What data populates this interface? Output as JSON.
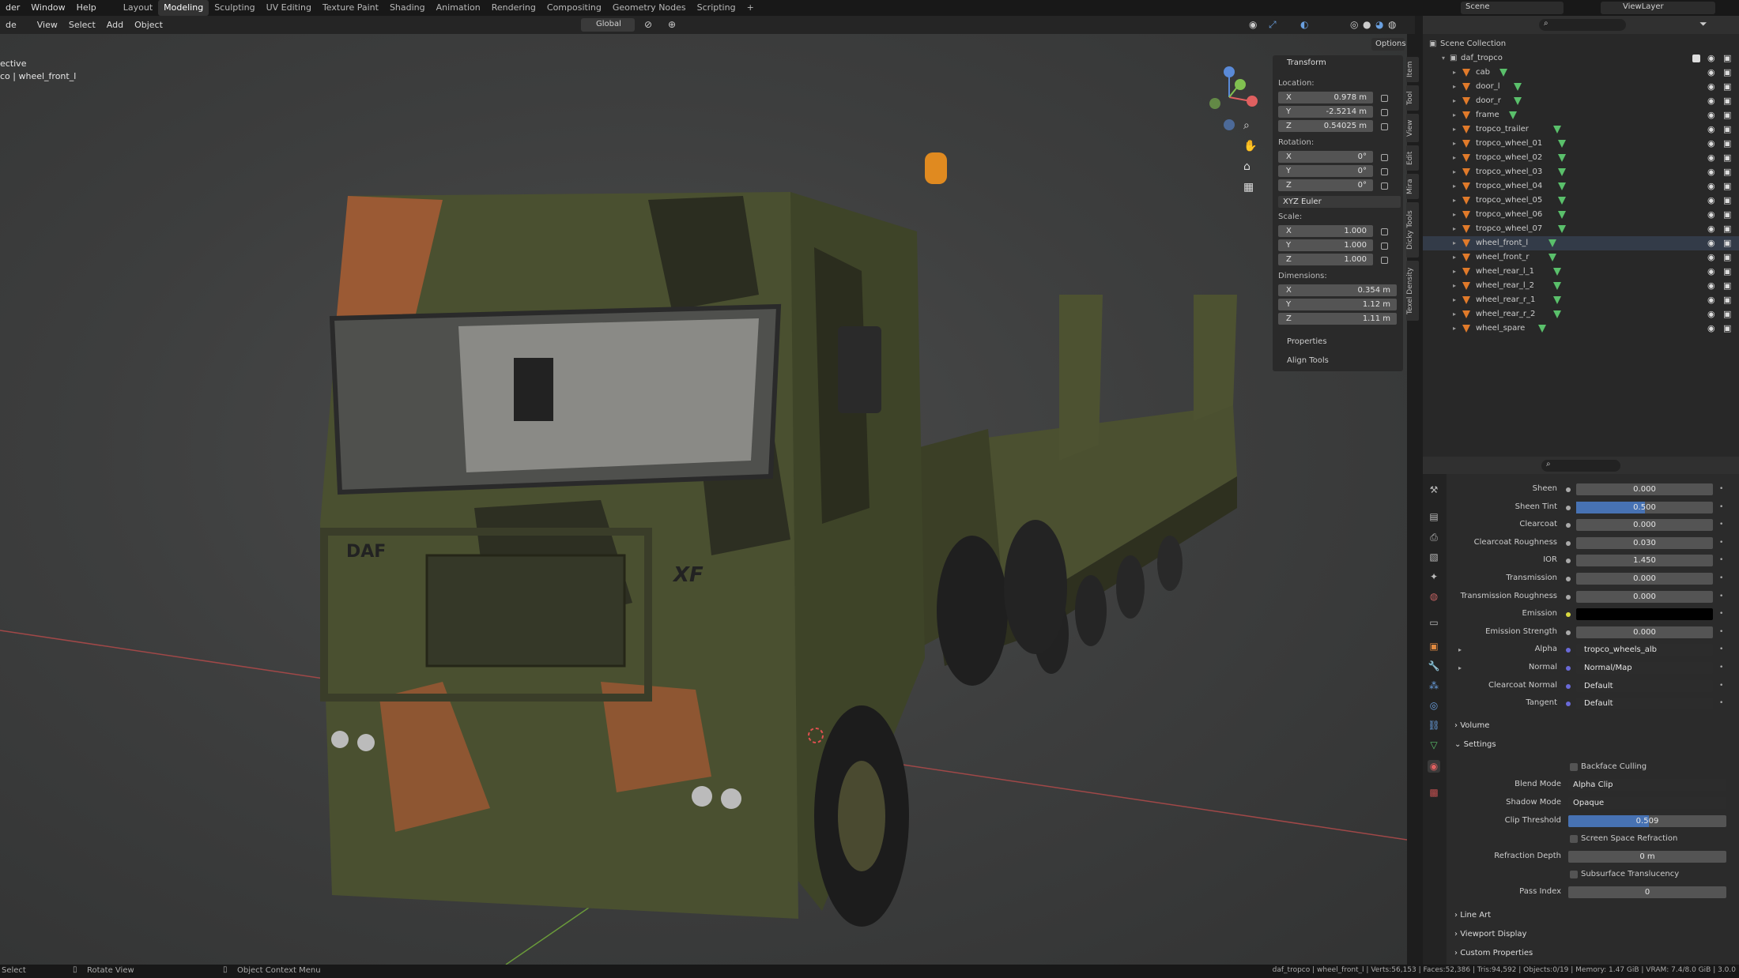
{
  "topbar": {
    "menus": [
      "der",
      "Window",
      "Help"
    ],
    "workspaces": [
      "Layout",
      "Modeling",
      "Sculpting",
      "UV Editing",
      "Texture Paint",
      "Shading",
      "Animation",
      "Rendering",
      "Compositing",
      "Geometry Nodes",
      "Scripting",
      "+"
    ],
    "active_workspace": "Modeling",
    "scene": "Scene",
    "view_layer": "ViewLayer"
  },
  "viewport_header": {
    "mode": "de",
    "menus": [
      "View",
      "Select",
      "Add",
      "Object"
    ],
    "orientation": "Global",
    "options_label": "Options"
  },
  "viewport": {
    "overlay_line1": "ective",
    "overlay_line2": "co | wheel_front_l",
    "truck_brand": "DAF",
    "truck_model": "XF"
  },
  "npanel": {
    "transform_title": "Transform",
    "location_label": "Location:",
    "location": [
      {
        "axis": "X",
        "value": "0.978 m"
      },
      {
        "axis": "Y",
        "value": "-2.5214 m"
      },
      {
        "axis": "Z",
        "value": "0.54025 m"
      }
    ],
    "rotation_label": "Rotation:",
    "rotation": [
      {
        "axis": "X",
        "value": "0°"
      },
      {
        "axis": "Y",
        "value": "0°"
      },
      {
        "axis": "Z",
        "value": "0°"
      }
    ],
    "rotation_mode": "XYZ Euler",
    "scale_label": "Scale:",
    "scale": [
      {
        "axis": "X",
        "value": "1.000"
      },
      {
        "axis": "Y",
        "value": "1.000"
      },
      {
        "axis": "Z",
        "value": "1.000"
      }
    ],
    "dimensions_label": "Dimensions:",
    "dimensions": [
      {
        "axis": "X",
        "value": "0.354 m"
      },
      {
        "axis": "Y",
        "value": "1.12 m"
      },
      {
        "axis": "Z",
        "value": "1.11 m"
      }
    ],
    "properties_label": "Properties",
    "align_label": "Align Tools",
    "side_tabs": [
      "Item",
      "Tool",
      "View",
      "Edit",
      "Mira",
      "Dicky Tools",
      "Texel Density"
    ]
  },
  "outliner": {
    "collection": "Scene Collection",
    "root": "daf_tropco",
    "items": [
      "cab",
      "door_l",
      "door_r",
      "frame",
      "tropco_trailer",
      "tropco_wheel_01",
      "tropco_wheel_02",
      "tropco_wheel_03",
      "tropco_wheel_04",
      "tropco_wheel_05",
      "tropco_wheel_06",
      "tropco_wheel_07",
      "wheel_front_l",
      "wheel_front_r",
      "wheel_rear_l_1",
      "wheel_rear_l_2",
      "wheel_rear_r_1",
      "wheel_rear_r_2",
      "wheel_spare"
    ]
  },
  "properties": {
    "rows": [
      {
        "label": "Sheen",
        "value": "0.000"
      },
      {
        "label": "Sheen Tint",
        "value": "0.500"
      },
      {
        "label": "Clearcoat",
        "value": "0.000"
      },
      {
        "label": "Clearcoat Roughness",
        "value": "0.030"
      },
      {
        "label": "IOR",
        "value": "1.450"
      },
      {
        "label": "Transmission",
        "value": "0.000"
      },
      {
        "label": "Transmission Roughness",
        "value": "0.000"
      },
      {
        "label": "Emission",
        "value": ""
      },
      {
        "label": "Emission Strength",
        "value": "0.000"
      },
      {
        "label": "Alpha",
        "value": "tropco_wheels_alb"
      },
      {
        "label": "Normal",
        "value": "Normal/Map"
      },
      {
        "label": "Clearcoat Normal",
        "value": "Default"
      },
      {
        "label": "Tangent",
        "value": "Default"
      }
    ],
    "sheen_tint_fill": 0.5,
    "volume_label": "Volume",
    "settings_label": "Settings",
    "backface": "Backface Culling",
    "blend_mode_label": "Blend Mode",
    "blend_mode": "Alpha Clip",
    "shadow_mode_label": "Shadow Mode",
    "shadow_mode": "Opaque",
    "clip_label": "Clip Threshold",
    "clip_value": "0.509",
    "clip_fill": 0.509,
    "ssr": "Screen Space Refraction",
    "refraction_label": "Refraction Depth",
    "refraction_value": "0 m",
    "sss": "Subsurface Translucency",
    "pass_label": "Pass Index",
    "pass_value": "0",
    "line_art": "Line Art",
    "viewport_display": "Viewport Display",
    "custom_props": "Custom Properties"
  },
  "statusbar": {
    "select": "Select",
    "rotate": "Rotate View",
    "context": "Object Context Menu",
    "stats": "daf_tropco | wheel_front_l | Verts:56,153 | Faces:52,386 | Tris:94,592 | Objects:0/19 | Memory: 1.47 GiB | VRAM: 7.4/8.0 GiB | 3.0.0"
  },
  "colors": {
    "accent": "#4772b3",
    "mesh": "#e07a2a",
    "data": "#5ac06b"
  }
}
